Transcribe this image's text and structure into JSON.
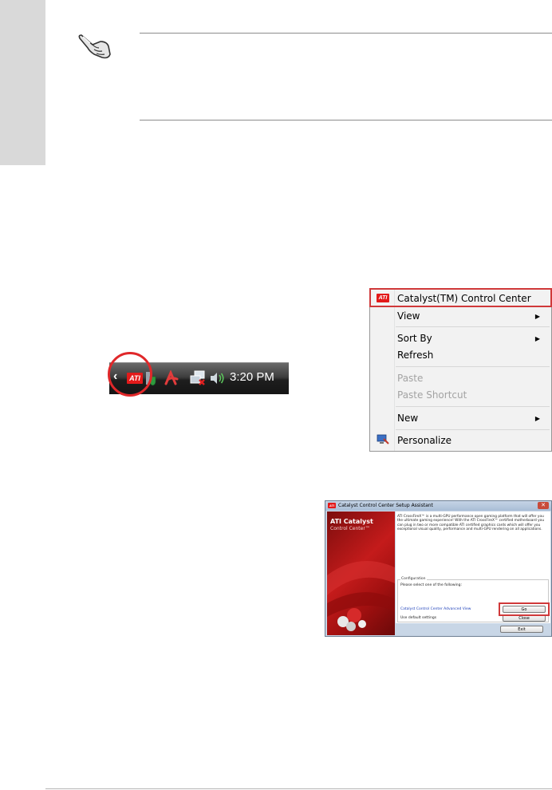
{
  "context_menu": {
    "items": [
      {
        "label": "Catalyst(TM) Control Center",
        "submenu": false,
        "disabled": false
      },
      {
        "label": "View",
        "submenu": true,
        "disabled": false
      },
      {
        "label": "Sort By",
        "submenu": true,
        "disabled": false
      },
      {
        "label": "Refresh",
        "submenu": false,
        "disabled": false
      },
      {
        "label": "Paste",
        "submenu": false,
        "disabled": true
      },
      {
        "label": "Paste Shortcut",
        "submenu": false,
        "disabled": true
      },
      {
        "label": "New",
        "submenu": true,
        "disabled": false
      },
      {
        "label": "Personalize",
        "submenu": false,
        "disabled": false
      }
    ],
    "ati_icon_text": "ATI"
  },
  "taskbar": {
    "time": "3:20 PM",
    "chevron": "‹",
    "ati_icon_text": "ATI"
  },
  "setup_window": {
    "title": "Catalyst Control Center Setup Assistant",
    "close_glyph": "✕",
    "banner_title": "ATI Catalyst",
    "banner_subtitle": "Control Center™",
    "description": "ATI CrossFireX™ is a multi-GPU performance open gaming platform that will offer you the ultimate gaming experience! With the ATI CrossFireX™ certified motherboard you can plug in two or more compatible ATI certified graphics cards which will offer you exceptional visual quality, performance and multi-GPU rendering on all applications.",
    "config_label": "Configuration",
    "config_prompt": "Please select one of the following:",
    "advanced_view_label": "Catalyst Control Center Advanced View",
    "default_settings_label": "Use default settings",
    "go_button": "Go",
    "close_button": "Close",
    "exit_button": "Exit"
  },
  "colors": {
    "highlight": "#d0393a",
    "ati_red": "#e31a1a"
  }
}
